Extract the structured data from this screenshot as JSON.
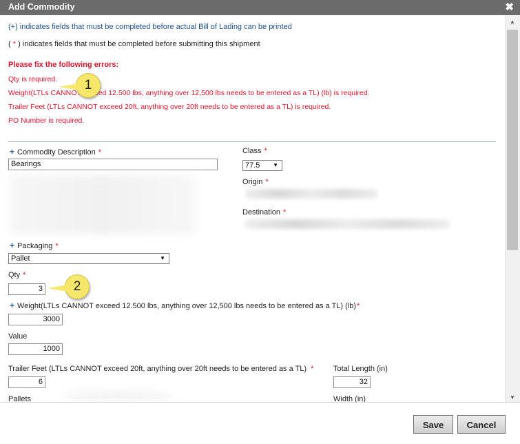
{
  "dialog": {
    "title": "Add Commodity",
    "close_glyph": "✖"
  },
  "notes": {
    "plus_note": "(+) indicates fields that must be completed before actual Bill of Lading can be printed",
    "star_note_prefix": "( ",
    "star_note_star": "*",
    "star_note_suffix": " ) indicates fields that must be completed before submitting this shipment"
  },
  "errors": {
    "title": "Please fix the following errors:",
    "items": [
      "Qty is required.",
      "Weight(LTLs CANNOT exceed 12.500 lbs, anything over 12,500 lbs needs to be entered as a TL) (lb) is required.",
      "Trailer Feet (LTLs CANNOT exceed 20ft, anything over 20ft needs to be entered as a TL) is required.",
      "PO Number is required."
    ]
  },
  "form": {
    "plus_glyph": "+",
    "required_glyph": "*",
    "commodity_description": {
      "label": "Commodity Description",
      "value": "Bearings"
    },
    "class": {
      "label": "Class",
      "value": "77.5"
    },
    "origin": {
      "label": "Origin"
    },
    "destination": {
      "label": "Destination"
    },
    "packaging": {
      "label": "Packaging",
      "value": "Pallet"
    },
    "qty": {
      "label": "Qty",
      "value": "3"
    },
    "weight": {
      "label": "Weight(LTLs CANNOT exceed 12.500 lbs, anything over 12,500 lbs needs to be entered as a TL) (lb)",
      "value": "3000"
    },
    "value": {
      "label": "Value",
      "value": "1000"
    },
    "trailer_feet": {
      "label": "Trailer Feet (LTLs CANNOT exceed 20ft, anything over 20ft needs to be entered as a TL)",
      "value": "6"
    },
    "total_length": {
      "label": "Total Length (in)",
      "value": "32"
    },
    "pallets": {
      "label": "Pallets"
    },
    "width": {
      "label": "Width (in)"
    }
  },
  "callouts": {
    "first": "1",
    "second": "2"
  },
  "icons": {
    "dropdown": "chevron-down-icon",
    "close": "close-icon",
    "scroll_up": "arrow-up-icon",
    "scroll_down": "arrow-down-icon"
  },
  "glyphs": {
    "dropdown": "▼",
    "scroll_up": "▲",
    "scroll_down": "▼"
  },
  "buttons": {
    "save": "Save",
    "cancel": "Cancel"
  },
  "colors": {
    "error": "#e0142b",
    "link_blue": "#1d4f91",
    "titlebar": "#6b6b6b",
    "callout": "#f6e66a"
  }
}
